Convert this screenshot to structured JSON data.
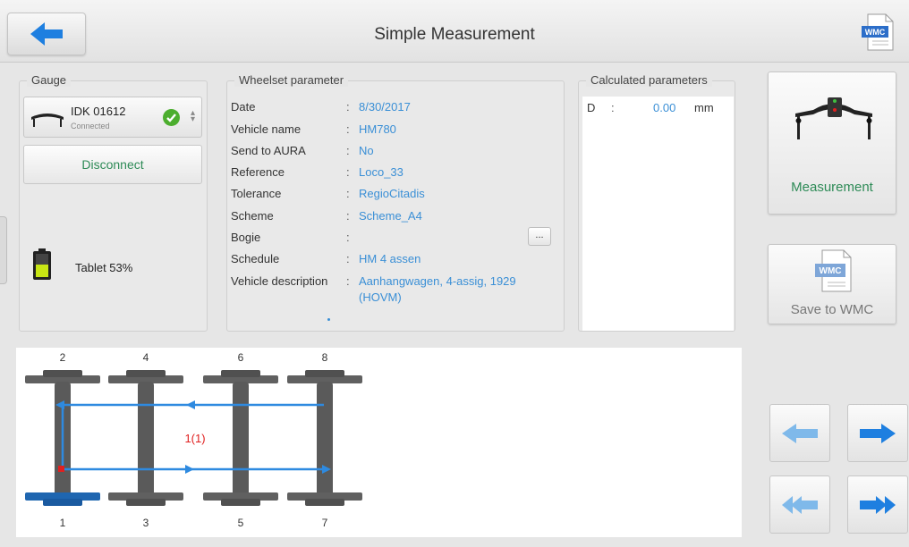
{
  "header": {
    "title": "Simple Measurement",
    "wmc_icon_label": "WMC"
  },
  "gauge": {
    "legend": "Gauge",
    "device_name": "IDK 01612",
    "status": "Connected",
    "disconnect_label": "Disconnect",
    "battery_label": "Tablet 53%",
    "battery_level": 0.53
  },
  "wheelset": {
    "legend": "Wheelset parameter",
    "rows": [
      {
        "label": "Date",
        "value": "8/30/2017"
      },
      {
        "label": "Vehicle name",
        "value": "HM780"
      },
      {
        "label": "Send to AURA",
        "value": "No"
      },
      {
        "label": "Reference",
        "value": "Loco_33"
      },
      {
        "label": "Tolerance",
        "value": "RegioCitadis"
      },
      {
        "label": "Scheme",
        "value": "Scheme_A4"
      },
      {
        "label": "Bogie",
        "value": ""
      },
      {
        "label": "Schedule",
        "value": "HM 4 assen"
      },
      {
        "label": "Vehicle description",
        "value": "Aanhangwagen, 4-assig, 1929",
        "value2": "(HOVM)"
      }
    ],
    "colon": ":",
    "bogie_button": "..."
  },
  "calculated": {
    "legend": "Calculated parameters",
    "param": "D",
    "colon": ":",
    "value": "0.00",
    "unit": "mm"
  },
  "actions": {
    "measurement_label": "Measurement",
    "save_label": "Save to WMC",
    "wmc_icon_label": "WMC"
  },
  "diagram": {
    "top_numbers": [
      "2",
      "4",
      "6",
      "8"
    ],
    "bottom_numbers": [
      "1",
      "3",
      "5",
      "7"
    ],
    "center_label": "1(1)"
  },
  "colors": {
    "accent": "#3a8fd6",
    "green": "#2e8b57",
    "marker": "#e02020"
  }
}
